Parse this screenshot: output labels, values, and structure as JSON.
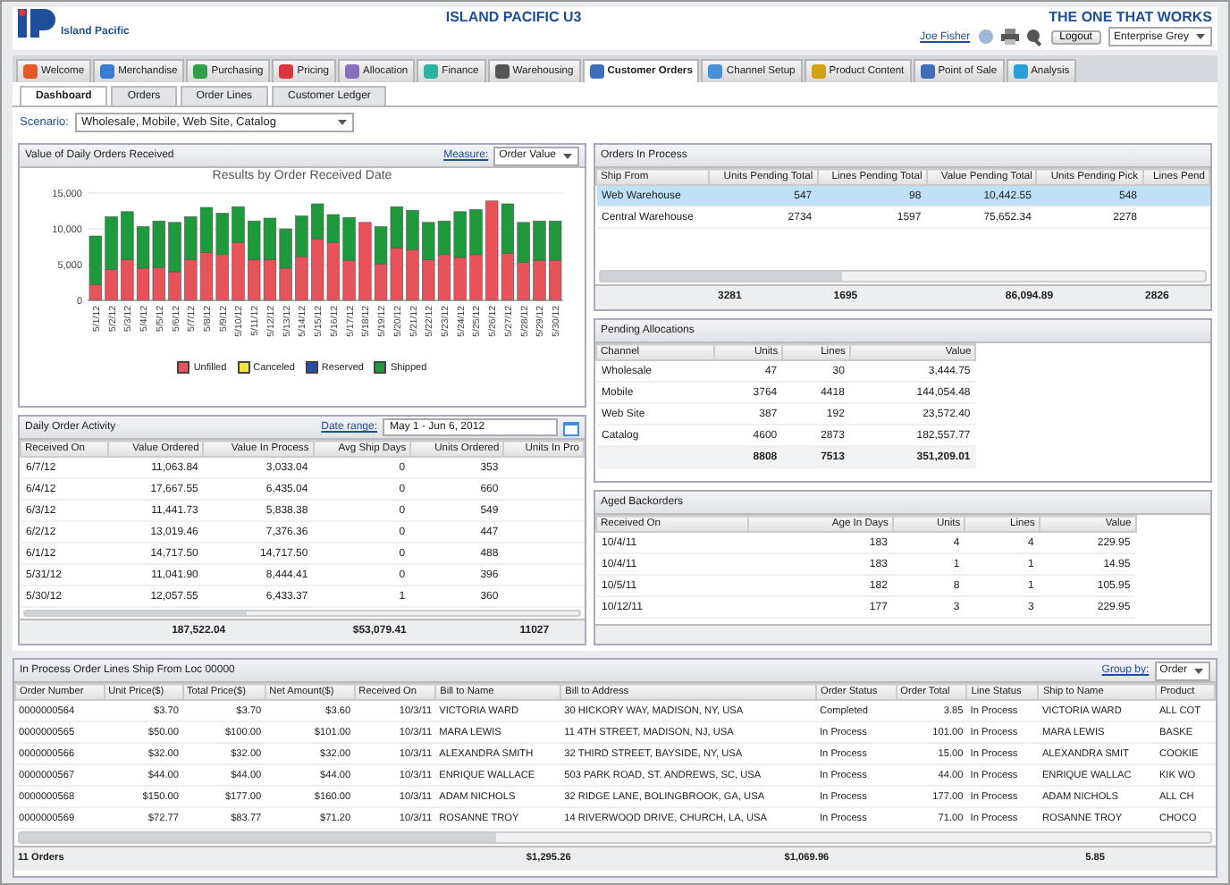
{
  "header": {
    "brand": "Island Pacific",
    "title": "ISLAND PACIFIC U3",
    "tagline": "THE ONE THAT WORKS",
    "user_link": "Joe Fisher",
    "logout": "Logout",
    "theme": "Enterprise Grey"
  },
  "module_tabs": [
    {
      "label": "Welcome",
      "selected": false
    },
    {
      "label": "Merchandise",
      "selected": false
    },
    {
      "label": "Purchasing",
      "selected": false
    },
    {
      "label": "Pricing",
      "selected": false
    },
    {
      "label": "Allocation",
      "selected": false
    },
    {
      "label": "Finance",
      "selected": false
    },
    {
      "label": "Warehousing",
      "selected": false
    },
    {
      "label": "Customer Orders",
      "selected": true
    },
    {
      "label": "Channel Setup",
      "selected": false
    },
    {
      "label": "Product Content",
      "selected": false
    },
    {
      "label": "Point of Sale",
      "selected": false
    },
    {
      "label": "Analysis",
      "selected": false
    }
  ],
  "sub_tabs": [
    {
      "label": "Dashboard",
      "selected": true
    },
    {
      "label": "Orders",
      "selected": false
    },
    {
      "label": "Order Lines",
      "selected": false
    },
    {
      "label": "Customer Ledger",
      "selected": false
    }
  ],
  "scenario": {
    "label": "Scenario:",
    "value": "Wholesale, Mobile, Web Site, Catalog"
  },
  "orders_chart_panel": {
    "title": "Value of Daily Orders Received",
    "measure_label": "Measure:",
    "measure_value": "Order Value",
    "chart_data": {
      "type": "bar",
      "stacked": true,
      "title": "Results by Order Received Date",
      "categories": [
        "5/1/12",
        "5/2/12",
        "5/3/12",
        "5/4/12",
        "5/5/12",
        "5/6/12",
        "5/7/12",
        "5/8/12",
        "5/9/12",
        "5/10/12",
        "5/11/12",
        "5/12/12",
        "5/13/12",
        "5/14/12",
        "5/15/12",
        "5/16/12",
        "5/17/12",
        "5/18/12",
        "5/19/12",
        "5/20/12",
        "5/21/12",
        "5/22/12",
        "5/23/12",
        "5/24/12",
        "5/25/12",
        "5/26/12",
        "5/27/12",
        "5/28/12",
        "5/29/12",
        "5/30/12"
      ],
      "series": [
        {
          "name": "Unfilled",
          "color": "#e8525a",
          "values": [
            2200,
            4300,
            5700,
            4500,
            4600,
            4000,
            5700,
            6700,
            6400,
            8100,
            5700,
            5700,
            4500,
            6100,
            8600,
            8100,
            5600,
            10900,
            5100,
            7300,
            7100,
            5700,
            6400,
            6000,
            6400,
            13900,
            6600,
            5300,
            5600,
            5600
          ]
        },
        {
          "name": "Canceled",
          "color": "#f2e63c",
          "values": [
            0,
            0,
            0,
            0,
            0,
            0,
            0,
            0,
            0,
            0,
            0,
            0,
            0,
            0,
            0,
            0,
            0,
            0,
            0,
            0,
            0,
            0,
            0,
            0,
            0,
            0,
            0,
            0,
            0,
            0
          ]
        },
        {
          "name": "Reserved",
          "color": "#1f4fa8",
          "values": [
            0,
            0,
            0,
            0,
            0,
            0,
            0,
            0,
            0,
            0,
            0,
            0,
            0,
            0,
            0,
            0,
            0,
            0,
            0,
            0,
            0,
            0,
            0,
            0,
            0,
            0,
            0,
            0,
            0,
            0
          ]
        },
        {
          "name": "Shipped",
          "color": "#1e9a3c",
          "values": [
            6800,
            7400,
            6700,
            5800,
            6500,
            6900,
            6000,
            6300,
            5800,
            5000,
            5400,
            5800,
            5500,
            5700,
            4900,
            3900,
            6000,
            0,
            5200,
            5800,
            5500,
            5200,
            4700,
            6400,
            6300,
            0,
            6900,
            5600,
            5500,
            5500
          ]
        }
      ],
      "ylim": [
        0,
        15000
      ],
      "yticks": [
        {
          "value": 0,
          "label": "0"
        },
        {
          "value": 5000,
          "label": "5,000"
        },
        {
          "value": 10000,
          "label": "10,000"
        },
        {
          "value": 15000,
          "label": "15,000"
        }
      ]
    }
  },
  "daily_activity": {
    "title": "Daily Order Activity",
    "date_range_label": "Date range:",
    "date_range": "May 1 - Jun 6, 2012",
    "columns": [
      {
        "label": "Received On"
      },
      {
        "label": "Value Ordered"
      },
      {
        "label": "Value In Process"
      },
      {
        "label": "Avg Ship Days"
      },
      {
        "label": "Units Ordered"
      },
      {
        "label": "Units In Pro"
      }
    ],
    "rows": [
      [
        "6/7/12",
        "11,063.84",
        "3,033.04",
        "0",
        "353"
      ],
      [
        "6/4/12",
        "17,667.55",
        "6,435.04",
        "0",
        "660"
      ],
      [
        "6/3/12",
        "11,441.73",
        "5,838.38",
        "0",
        "549"
      ],
      [
        "6/2/12",
        "13,019.46",
        "7,376.36",
        "0",
        "447"
      ],
      [
        "6/1/12",
        "14,717.50",
        "14,717.50",
        "0",
        "488"
      ],
      [
        "5/31/12",
        "11,041.90",
        "8,444.41",
        "0",
        "396"
      ],
      [
        "5/30/12",
        "12,057.55",
        "6,433.37",
        "1",
        "360"
      ]
    ],
    "totals": {
      "value_ordered": "187,522.04",
      "value_in_process": "$53,079.41",
      "units_ordered": "11027"
    }
  },
  "orders_in_process": {
    "title": "Orders In Process",
    "columns": [
      {
        "label": "Ship From"
      },
      {
        "label": "Units Pending Total"
      },
      {
        "label": "Lines Pending Total"
      },
      {
        "label": "Value Pending Total"
      },
      {
        "label": "Units Pending Pick"
      },
      {
        "label": "Lines Pend"
      }
    ],
    "rows": [
      {
        "cells": [
          "Web Warehouse",
          "547",
          "98",
          "10,442.55",
          "548"
        ],
        "selected": true
      },
      {
        "cells": [
          "Central Warehouse",
          "2734",
          "1597",
          "75,652.34",
          "2278"
        ],
        "selected": false
      }
    ],
    "totals": {
      "units_pending_total": "3281",
      "lines_pending_total": "1695",
      "value_pending_total": "86,094.89",
      "units_pending_pick": "2826"
    }
  },
  "pending_allocations": {
    "title": "Pending Allocations",
    "columns": [
      {
        "label": "Channel"
      },
      {
        "label": "Units"
      },
      {
        "label": "Lines"
      },
      {
        "label": "Value"
      }
    ],
    "rows": [
      [
        "Wholesale",
        "47",
        "30",
        "3,444.75"
      ],
      [
        "Mobile",
        "3764",
        "4418",
        "144,054.48"
      ],
      [
        "Web Site",
        "387",
        "192",
        "23,572.40"
      ],
      [
        "Catalog",
        "4600",
        "2873",
        "182,557.77"
      ]
    ],
    "totals": {
      "units": "8808",
      "lines": "7513",
      "value": "351,209.01"
    }
  },
  "aged_backorders": {
    "title": "Aged Backorders",
    "columns": [
      "Received On",
      "Age In Days",
      "Units",
      "Lines",
      "Value"
    ],
    "rows": [
      [
        "10/4/11",
        "183",
        "4",
        "4",
        "229.95"
      ],
      [
        "10/4/11",
        "183",
        "1",
        "1",
        "14.95"
      ],
      [
        "10/5/11",
        "182",
        "8",
        "1",
        "105.95"
      ],
      [
        "10/12/11",
        "177",
        "3",
        "3",
        "229.95"
      ]
    ]
  },
  "order_lines": {
    "title": "In Process Order Lines Ship From Loc 00000",
    "group_by_label": "Group by:",
    "group_by": "Order",
    "columns": [
      {
        "label": "Order Number"
      },
      {
        "label": "Unit Price($)"
      },
      {
        "label": "Total Price($)"
      },
      {
        "label": "Net Amount($)"
      },
      {
        "label": "Received On"
      },
      {
        "label": "Bill to Name"
      },
      {
        "label": "Bill to Address"
      },
      {
        "label": "Order Status"
      },
      {
        "label": "Order Total"
      },
      {
        "label": "Line Status"
      },
      {
        "label": "Ship to Name"
      },
      {
        "label": "Product"
      }
    ],
    "rows": [
      [
        "0000000564",
        "$3.70",
        "$3.70",
        "$3.60",
        "10/3/11",
        "VICTORIA WARD",
        "30 HICKORY WAY, MADISON, NY, USA",
        "Completed",
        "3.85",
        "In Process",
        "VICTORIA WARD",
        "ALL COT"
      ],
      [
        "0000000565",
        "$50.00",
        "$100.00",
        "$101.00",
        "10/3/11",
        "MARA LEWIS",
        "11 4TH STREET, MADISON, NJ, USA",
        "In Process",
        "101.00",
        "In Process",
        "MARA LEWIS",
        "BASKE"
      ],
      [
        "0000000566",
        "$32.00",
        "$32.00",
        "$32.00",
        "10/3/11",
        "ALEXANDRA SMITH",
        "32 THIRD STREET, BAYSIDE, NY, USA",
        "In Process",
        "15.00",
        "In Process",
        "ALEXANDRA SMIT",
        "COOKIE"
      ],
      [
        "0000000567",
        "$44.00",
        "$44.00",
        "$44.00",
        "10/3/11",
        "ENRIQUE WALLACE",
        "503 PARK ROAD, ST. ANDREWS, SC, USA",
        "In Process",
        "44.00",
        "In Process",
        "ENRIQUE WALLAC",
        "KIK WO"
      ],
      [
        "0000000568",
        "$150.00",
        "$177.00",
        "$160.00",
        "10/3/11",
        "ADAM NICHOLS",
        "32 RIDGE LANE, BOLINGBROOK, GA, USA",
        "In Process",
        "177.00",
        "In Process",
        "ADAM NICHOLS",
        "ALL CH"
      ],
      [
        "0000000569",
        "$72.77",
        "$83.77",
        "$71.20",
        "10/3/11",
        "ROSANNE TROY",
        "14 RIVERWOOD DRIVE, CHURCH, LA, USA",
        "In Process",
        "71.00",
        "In Process",
        "ROSANNE TROY",
        "CHOCO"
      ]
    ],
    "totals": {
      "order_count": "11 Orders",
      "total_price": "$1,295.26",
      "net_amount": "$1,069.96",
      "order_total": "5.85"
    }
  }
}
